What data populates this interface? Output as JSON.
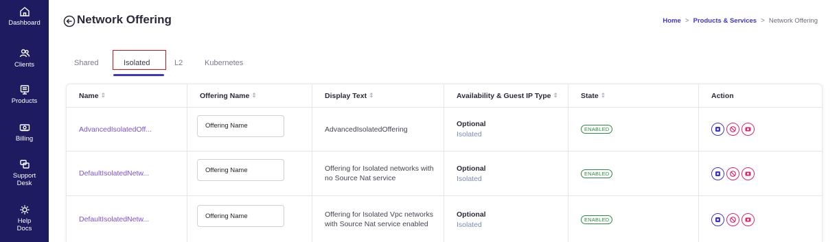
{
  "sidebar": {
    "items": [
      {
        "label": "Dashboard",
        "icon": "home-icon"
      },
      {
        "label": "Clients",
        "icon": "users-icon"
      },
      {
        "label": "Products",
        "icon": "server-icon"
      },
      {
        "label": "Billing",
        "icon": "money-icon"
      },
      {
        "label": "Support",
        "label2": "Desk",
        "icon": "support-icon"
      },
      {
        "label": "Help",
        "label2": "Docs",
        "icon": "gear-icon"
      }
    ]
  },
  "header": {
    "title": "Network Offering",
    "breadcrumb": {
      "home": "Home",
      "section": "Products & Services",
      "current": "Network Offering",
      "separator": ">"
    }
  },
  "tabs": [
    "Shared",
    "Isolated",
    "L2",
    "Kubernetes"
  ],
  "active_tab": "Isolated",
  "table": {
    "columns": [
      "Name",
      "Offering Name",
      "Display Text",
      "Availability & Guest IP Type",
      "State",
      "Action"
    ],
    "sort_glyph": "⇕",
    "rows": [
      {
        "name": "AdvancedIsolatedOff...",
        "offering_placeholder": "Offering Name",
        "display_text": "AdvancedIsolatedOffering",
        "availability": "Optional",
        "guest_ip_type": "Isolated",
        "state": "ENABLED"
      },
      {
        "name": "DefaultIsolatedNetw...",
        "offering_placeholder": "Offering Name",
        "display_text": "Offering for Isolated networks with no Source Nat service",
        "availability": "Optional",
        "guest_ip_type": "Isolated",
        "state": "ENABLED"
      },
      {
        "name": "DefaultIsolatedNetw...",
        "offering_placeholder": "Offering Name",
        "display_text": "Offering for Isolated Vpc networks with Source Nat service enabled",
        "availability": "Optional",
        "guest_ip_type": "Isolated",
        "state": "ENABLED"
      }
    ]
  },
  "colors": {
    "sidebar_bg": "#1e1b60",
    "accent": "#3b36c9",
    "link": "#7a4fd9",
    "enabled": "#2c8a3e",
    "highlight_box": "#d0121b",
    "danger": "#e0246a"
  }
}
